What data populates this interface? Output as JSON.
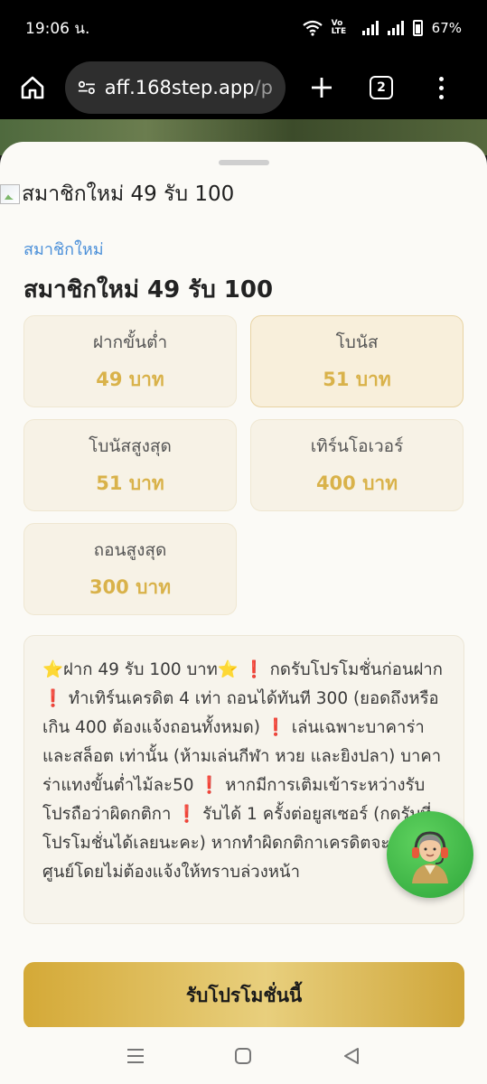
{
  "status": {
    "time": "19:06 น.",
    "volte": "Vo LTE",
    "battery": "67%"
  },
  "browser": {
    "url_host": "aff.168step.app",
    "url_rest": "/pro",
    "tab_count": "2"
  },
  "promo": {
    "banner_alt": "สมาชิกใหม่ 49 รับ 100",
    "category": "สมาชิกใหม่",
    "title": "สมาชิกใหม่ 49 รับ 100",
    "stats": [
      {
        "label": "ฝากขั้นต่ำ",
        "value": "49 บาท"
      },
      {
        "label": "โบนัส",
        "value": "51 บาท"
      },
      {
        "label": "โบนัสสูงสุด",
        "value": "51 บาท"
      },
      {
        "label": "เทิร์นโอเวอร์",
        "value": "400 บาท"
      },
      {
        "label": "ถอนสูงสุด",
        "value": "300 บาท"
      }
    ],
    "description": "⭐ฝาก 49 รับ 100 บาท⭐ ❗ กดรับโปรโมชั่นก่อนฝาก ❗ ทำเทิร์นเครดิต 4 เท่า ถอนได้ทันที 300 (ยอดถึงหรือเกิน 400 ต้องแจ้งถอนทั้งหมด) ❗ เล่นเฉพาะบาคาร่าและสล็อต เท่านั้น (ห้ามเล่นกีฬา หวย และยิงปลา) บาคาร่าแทงขั้นต่ำไม้ละ50 ❗ หากมีการเติมเข้าระหว่างรับโปรถือว่าผิดกติกา ❗ รับได้ 1 ครั้งต่อยูสเซอร์ (กดรับที่โปรโมชั่นได้เลยนะคะ) หากทำผิดกติกาเครดิตจะตัดเป็นศูนย์โดยไม่ต้องแจ้งให้ทราบล่วงหน้า",
    "claim_label": "รับโปรโมชั่นนี้"
  },
  "colors": {
    "accent_gold": "#d9b24a",
    "category_blue": "#4a8fd9",
    "fab_green": "#2ea63a"
  },
  "icons": [
    "home-icon",
    "site-settings-icon",
    "plus-icon",
    "tabs-icon",
    "more-menu-icon",
    "support-agent-icon",
    "recents-icon",
    "home-nav-icon",
    "back-icon"
  ]
}
